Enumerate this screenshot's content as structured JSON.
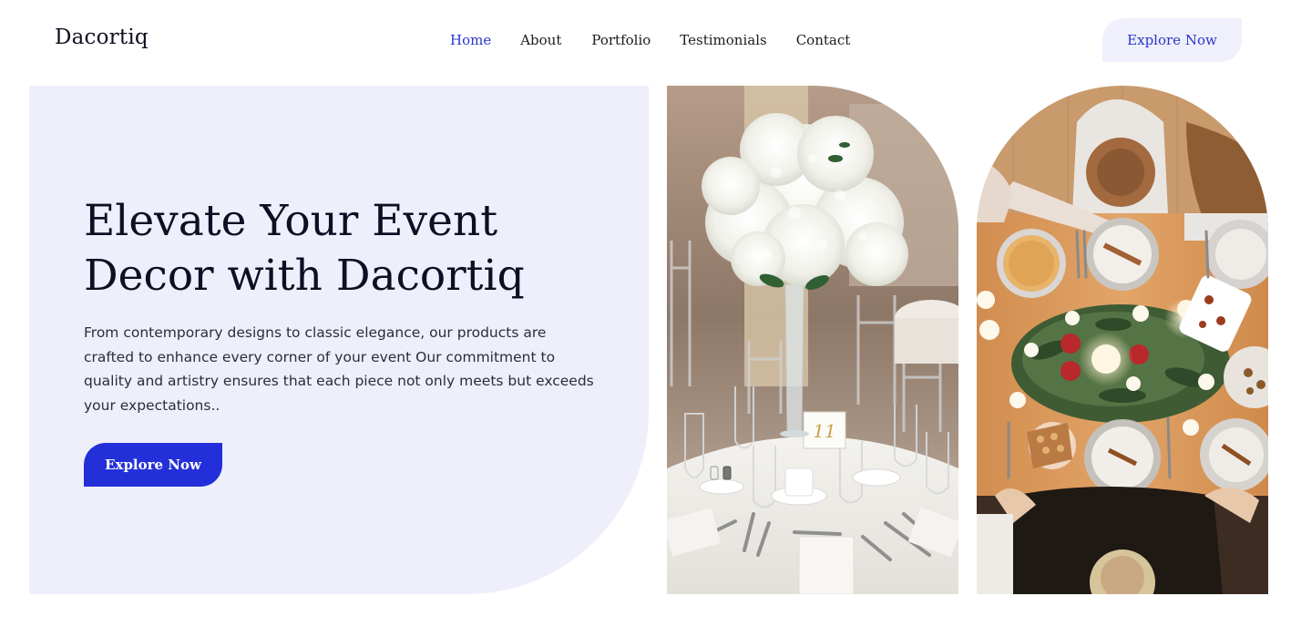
{
  "brand": {
    "name": "Dacortiq"
  },
  "nav": {
    "items": [
      {
        "label": "Home",
        "active": true
      },
      {
        "label": "About",
        "active": false
      },
      {
        "label": "Portfolio",
        "active": false
      },
      {
        "label": "Testimonials",
        "active": false
      },
      {
        "label": "Contact",
        "active": false
      }
    ],
    "cta_label": "Explore Now"
  },
  "hero": {
    "title_line1": "Elevate Your Event",
    "title_line2": "Decor with Dacortiq",
    "description": "From contemporary designs to classic elegance, our products are crafted to enhance every corner of your event Our commitment to quality and artistry ensures that each piece not only meets but exceeds your expectations..",
    "cta_label": "Explore Now"
  },
  "images": {
    "left": {
      "icon": "wedding-table-photo"
    },
    "right": {
      "icon": "dinner-table-photo"
    },
    "table_card_number": "11"
  },
  "colors": {
    "accent": "#2330d9",
    "nav_active": "#2a36c8",
    "panel_bg": "#efeffc",
    "cta_light_bg": "#eff0fc"
  }
}
